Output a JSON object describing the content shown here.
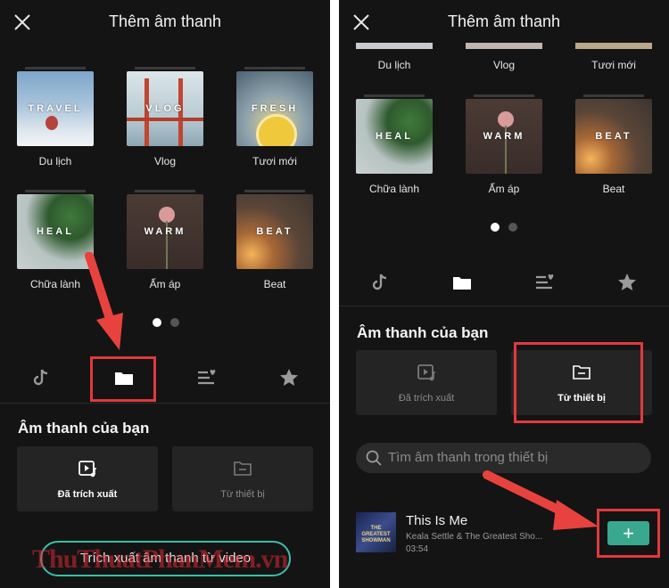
{
  "left": {
    "title": "Thêm âm thanh",
    "tiles": [
      {
        "word": "TRAVEL",
        "label": "Du lịch"
      },
      {
        "word": "VLOG",
        "label": "Vlog"
      },
      {
        "word": "FRESH",
        "label": "Tươi mới"
      },
      {
        "word": "HEAL",
        "label": "Chữa lành"
      },
      {
        "word": "WARM",
        "label": "Ấm áp"
      },
      {
        "word": "BEAT",
        "label": "Beat"
      }
    ],
    "section_title": "Âm thanh của bạn",
    "card_extracted": "Đã trích xuất",
    "card_device": "Từ thiết bị",
    "extract_button": "Trích xuất âm thanh từ video",
    "watermark": "ThuThuatPhanMem.vn"
  },
  "right": {
    "title": "Thêm âm thanh",
    "top_labels": [
      "Du lịch",
      "Vlog",
      "Tươi mới"
    ],
    "tiles": [
      {
        "word": "HEAL",
        "label": "Chữa lành"
      },
      {
        "word": "WARM",
        "label": "Ấm áp"
      },
      {
        "word": "BEAT",
        "label": "Beat"
      }
    ],
    "section_title": "Âm thanh của bạn",
    "card_extracted": "Đã trích xuất",
    "card_device": "Từ thiết bị",
    "search_placeholder": "Tìm âm thanh trong thiết bị",
    "song": {
      "title": "This Is Me",
      "artist": "Keala Settle & The Greatest Sho...",
      "duration": "03:54",
      "cover_text": "THE GREATEST SHOWMAN"
    },
    "add_button": "+"
  },
  "icons": [
    "close-icon",
    "tiktok-icon",
    "folder-icon",
    "playlist-heart-icon",
    "star-icon",
    "video-music-icon",
    "search-icon",
    "arrow-icon"
  ],
  "colors": {
    "background": "#141414",
    "highlight": "#e0393e",
    "accent": "#3bbfa8",
    "add_button": "#3aa88f"
  }
}
